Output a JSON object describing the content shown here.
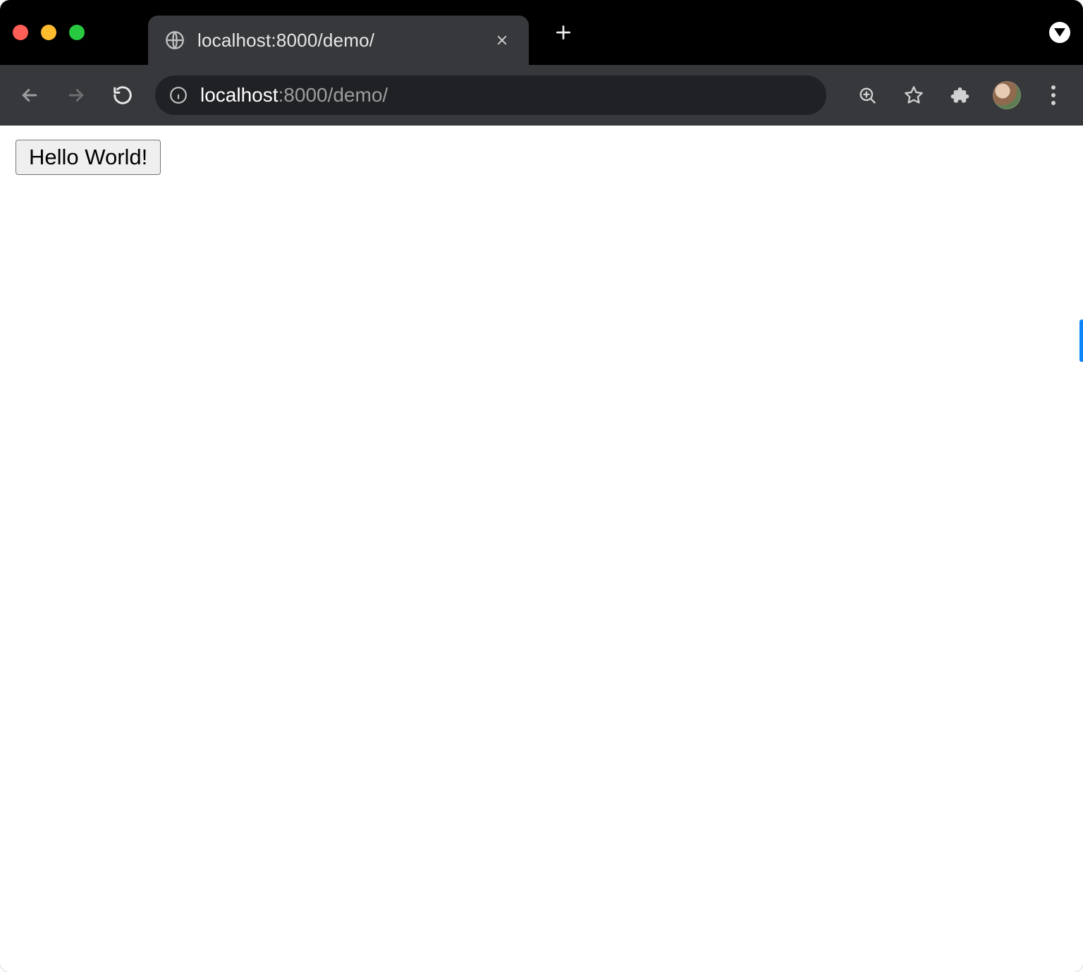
{
  "tab": {
    "title": "localhost:8000/demo/"
  },
  "address": {
    "host": "localhost",
    "rest": ":8000/demo/"
  },
  "page": {
    "hello_button_label": "Hello World!"
  }
}
